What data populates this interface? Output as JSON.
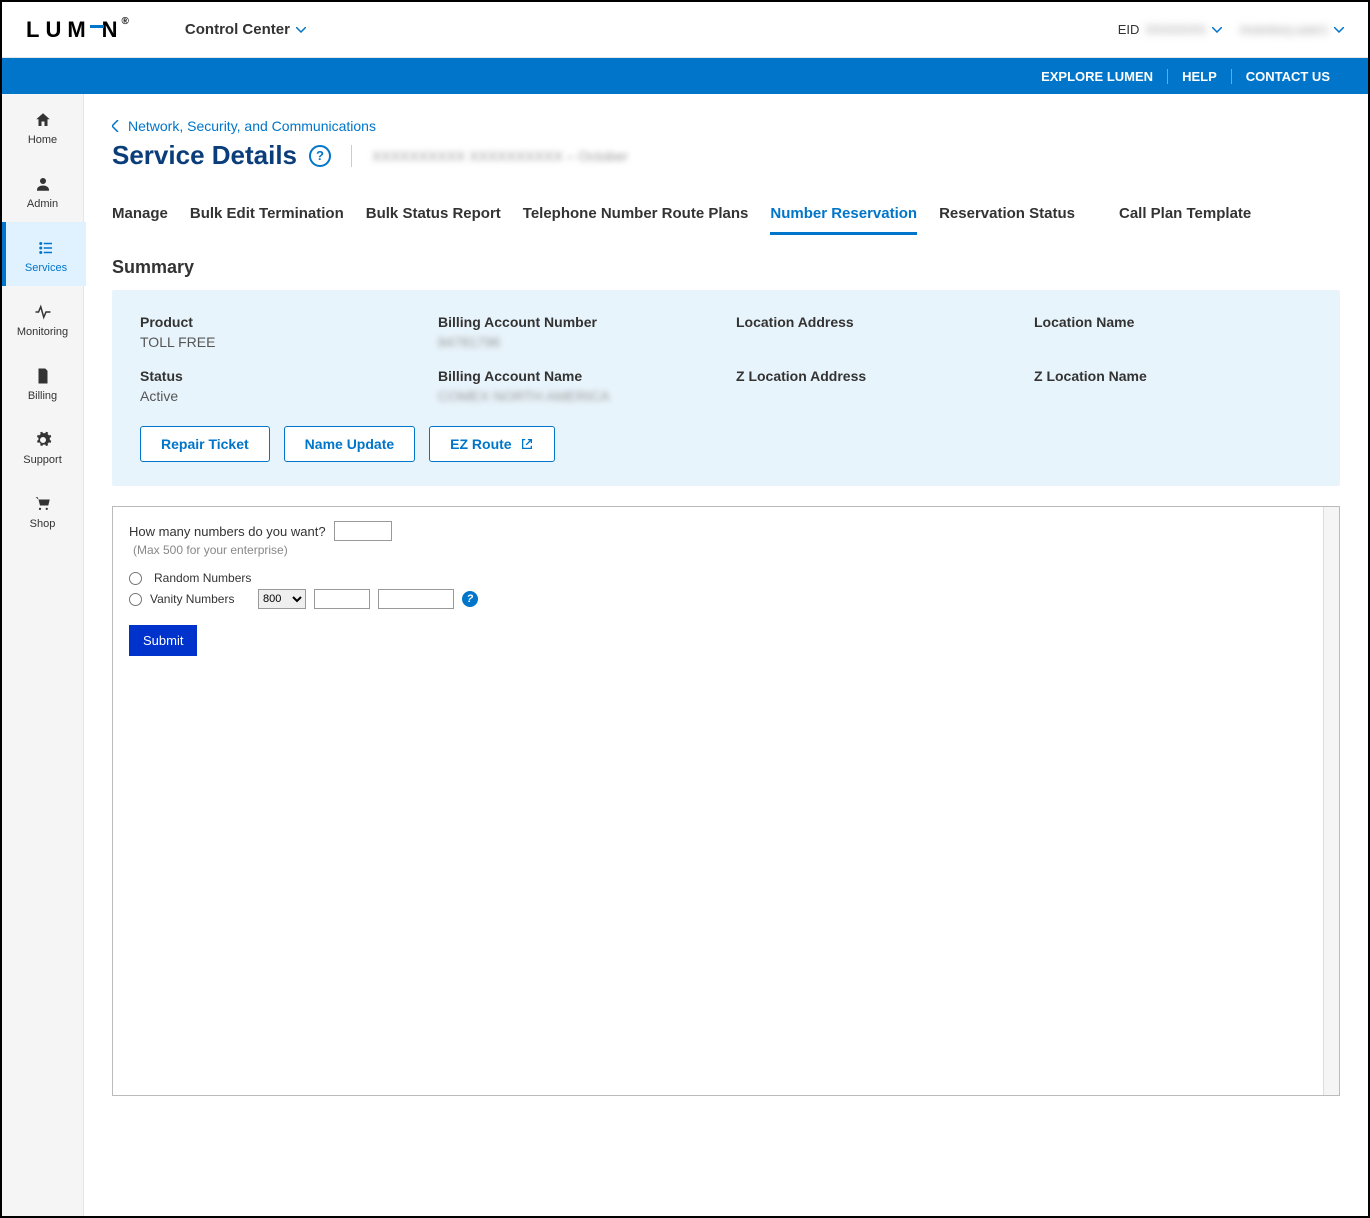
{
  "header": {
    "logo_text": "LUM",
    "logo_text2": "N",
    "control_center": "Control Center",
    "eid_label": "EID",
    "eid_value": "XXXXXXX",
    "user_value": "inventory.user1"
  },
  "bluebar": {
    "explore": "EXPLORE LUMEN",
    "help": "HELP",
    "contact": "CONTACT US"
  },
  "sidebar": {
    "home": "Home",
    "admin": "Admin",
    "services": "Services",
    "monitoring": "Monitoring",
    "billing": "Billing",
    "support": "Support",
    "shop": "Shop"
  },
  "breadcrumb": "Network, Security, and Communications",
  "page_title": "Service Details",
  "title_meta": "XXXXXXXXXX   XXXXXXXXXX – October",
  "tabs": {
    "manage": "Manage",
    "bulk_edit": "Bulk Edit Termination",
    "bulk_status": "Bulk Status Report",
    "route_plans": "Telephone Number Route Plans",
    "number_reservation": "Number Reservation",
    "reservation_status": "Reservation Status",
    "call_plan": "Call Plan Template"
  },
  "summary": {
    "title": "Summary",
    "product_label": "Product",
    "product_value": "TOLL FREE",
    "ban_label": "Billing Account Number",
    "ban_value": "84781796",
    "location_address_label": "Location Address",
    "location_name_label": "Location Name",
    "status_label": "Status",
    "status_value": "Active",
    "ban_name_label": "Billing Account Name",
    "ban_name_value": "COMEX NORTH AMERICA",
    "z_location_address_label": "Z Location Address",
    "z_location_name_label": "Z Location Name",
    "repair_ticket": "Repair Ticket",
    "name_update": "Name Update",
    "ez_route": "EZ Route"
  },
  "reservation": {
    "question": "How many numbers do you want?",
    "hint": "(Max 500 for your enterprise)",
    "random": "Random Numbers",
    "vanity": "Vanity Numbers",
    "prefix": "800",
    "submit": "Submit"
  }
}
